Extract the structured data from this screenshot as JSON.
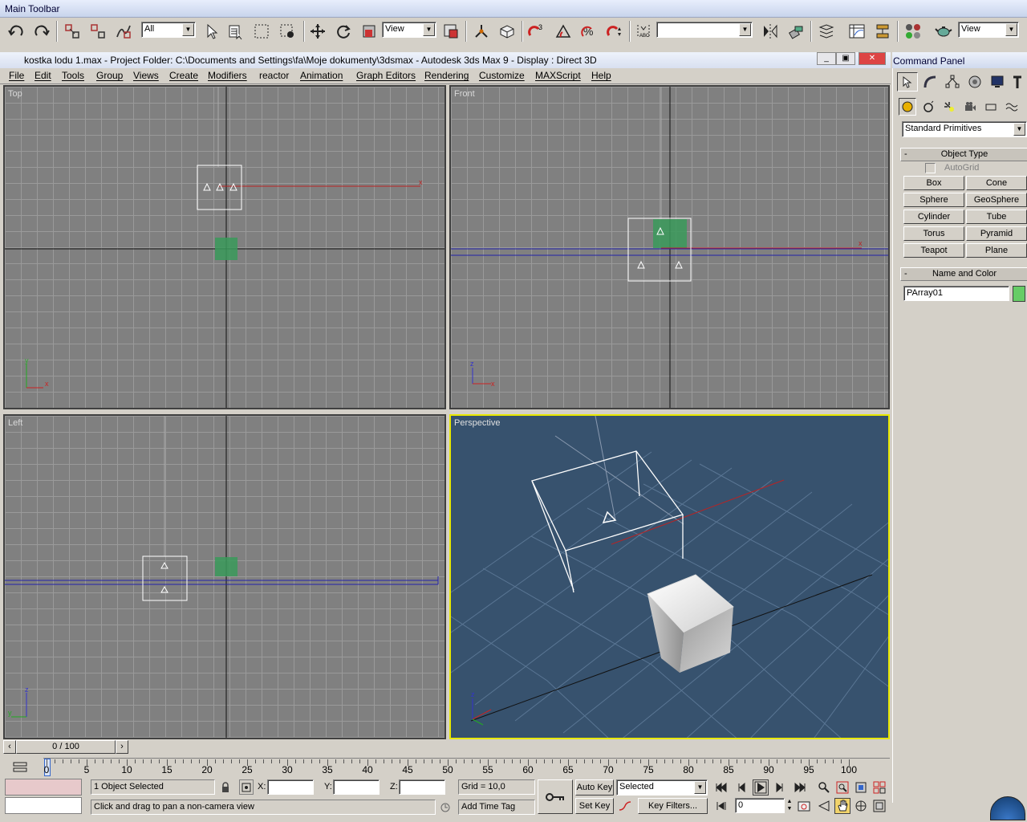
{
  "toolbar": {
    "title": "Main Toolbar",
    "selection_filter": "All",
    "ref_coord": "View",
    "named_selection": "",
    "ref_coord_2": "View"
  },
  "window": {
    "title": "kostka lodu 1.max     - Project Folder: C:\\Documents and Settings\\fa\\Moje dokumenty\\3dsmax     - Autodesk 3ds Max 9     - Display : Direct 3D"
  },
  "menu": [
    "File",
    "Edit",
    "Tools",
    "Group",
    "Views",
    "Create",
    "Modifiers",
    "reactor",
    "Animation",
    "Graph Editors",
    "Rendering",
    "Customize",
    "MAXScript",
    "Help"
  ],
  "viewports": {
    "top": "Top",
    "front": "Front",
    "left": "Left",
    "perspective": "Perspective"
  },
  "command_panel": {
    "title": "Command Panel",
    "category": "Standard Primitives",
    "object_type_title": "Object Type",
    "autogrid": "AutoGrid",
    "buttons": [
      "Box",
      "Cone",
      "Sphere",
      "GeoSphere",
      "Cylinder",
      "Tube",
      "Torus",
      "Pyramid",
      "Teapot",
      "Plane"
    ],
    "name_color_title": "Name and Color",
    "object_name": "PArray01",
    "object_color": "#66cc66",
    "collapse_symbol": "-"
  },
  "timeline": {
    "slider_label": "0 / 100",
    "ticks": [
      "0",
      "5",
      "10",
      "15",
      "20",
      "25",
      "30",
      "35",
      "40",
      "45",
      "50",
      "55",
      "60",
      "65",
      "70",
      "75",
      "80",
      "85",
      "90",
      "95",
      "100"
    ]
  },
  "status": {
    "selection": "1 Object Selected",
    "prompt": "Click and drag to pan a non-camera view",
    "x_label": "X:",
    "y_label": "Y:",
    "z_label": "Z:",
    "grid": "Grid = 10,0",
    "add_time_tag": "Add Time Tag",
    "auto_key": "Auto Key",
    "set_key": "Set Key",
    "key_mode": "Selected",
    "key_filters": "Key Filters...",
    "current_frame": "0"
  },
  "colors": {
    "accent": "#e8e800",
    "perspective_bg": "#37526e",
    "viewport_bg": "#808080"
  }
}
